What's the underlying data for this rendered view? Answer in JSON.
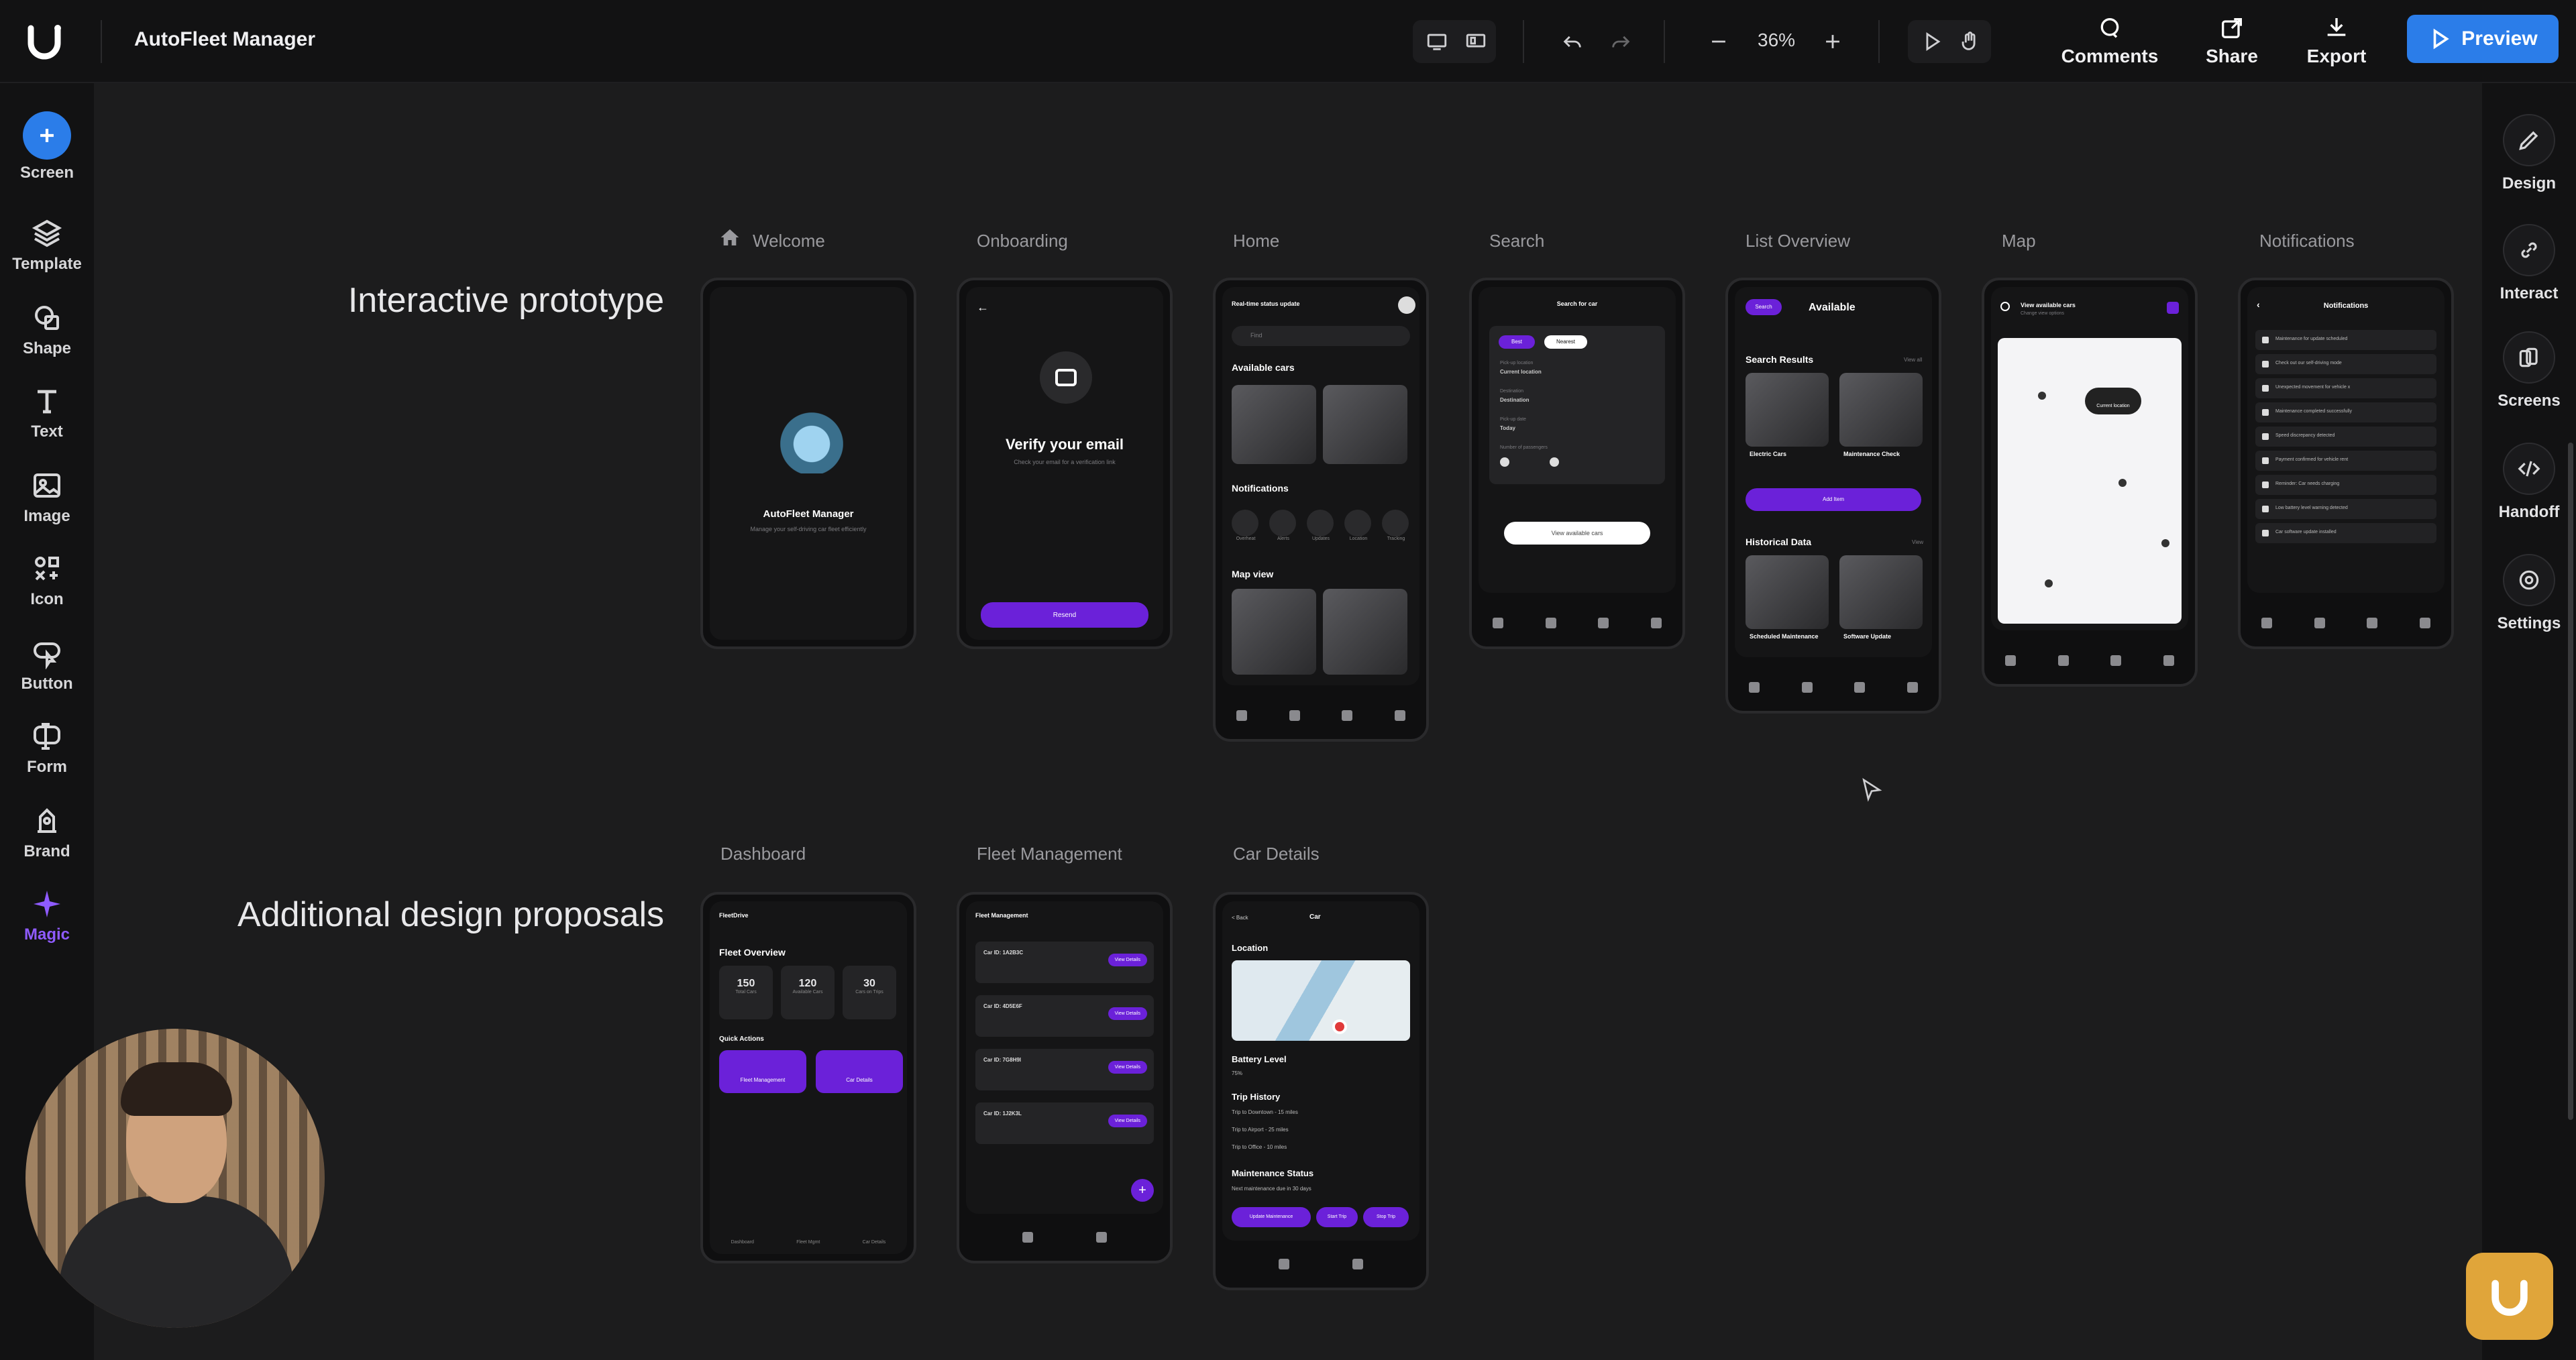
{
  "topbar": {
    "app_title": "AutoFleet Manager",
    "zoom": "36%",
    "actions": {
      "comments": "Comments",
      "share": "Share",
      "export": "Export"
    },
    "preview": "Preview"
  },
  "left_toolbar": [
    {
      "label": "Screen",
      "icon": "plus-icon"
    },
    {
      "label": "Template",
      "icon": "layers-icon"
    },
    {
      "label": "Shape",
      "icon": "shape-icon"
    },
    {
      "label": "Text",
      "icon": "text-icon"
    },
    {
      "label": "Image",
      "icon": "image-icon"
    },
    {
      "label": "Icon",
      "icon": "icon-grid-icon"
    },
    {
      "label": "Button",
      "icon": "button-icon"
    },
    {
      "label": "Form",
      "icon": "form-icon"
    },
    {
      "label": "Brand",
      "icon": "brand-icon"
    },
    {
      "label": "Magic",
      "icon": "sparkle-icon"
    }
  ],
  "right_toolbar": [
    {
      "label": "Design",
      "icon": "pencil-icon"
    },
    {
      "label": "Interact",
      "icon": "link-icon"
    },
    {
      "label": "Screens",
      "icon": "screens-icon"
    },
    {
      "label": "Handoff",
      "icon": "code-icon"
    },
    {
      "label": "Settings",
      "icon": "gear-icon"
    }
  ],
  "sections": {
    "prototype": "Interactive prototype",
    "proposals": "Additional design proposals"
  },
  "screens_row1": [
    "Welcome",
    "Onboarding",
    "Home",
    "Search",
    "List Overview",
    "Map",
    "Notifications"
  ],
  "screens_row2": [
    "Dashboard",
    "Fleet Management",
    "Car Details"
  ],
  "phones": {
    "welcome": {
      "title": "AutoFleet Manager",
      "subtitle": "Manage your self-driving car fleet efficiently"
    },
    "onboarding": {
      "title": "Verify your email",
      "subtitle": "Check your email for a verification link",
      "button": "Resend"
    },
    "home": {
      "header": "Real-time status update",
      "search": "Find",
      "available": "Available cars",
      "notifications": "Notifications",
      "mapview": "Map view",
      "notif_items": [
        "Overheat",
        "Alerts",
        "Updates",
        "Location",
        "Tracking"
      ]
    },
    "search": {
      "header": "Search for car",
      "tab_a": "Best",
      "tab_b": "Nearest",
      "f1": "Pick-up location",
      "v1": "Current location",
      "f2": "Destination",
      "v2": "Destination",
      "f3": "Pick-up date",
      "v3": "Today",
      "f4": "Number of passengers",
      "button": "View available cars"
    },
    "list": {
      "chip": "Search",
      "title": "Available",
      "results": "Search Results",
      "viewall": "View all",
      "c1": "Electric Cars",
      "c2": "Maintenance Check",
      "add": "Add Item",
      "hist": "Historical Data",
      "view": "View",
      "h1": "Scheduled Maintenance",
      "h2": "Software Update"
    },
    "map": {
      "title": "View available cars",
      "subtitle": "Change view options",
      "pin": "Current location"
    },
    "notifications": {
      "title": "Notifications",
      "items": [
        "Maintenance for update scheduled",
        "Check out our self-driving mode",
        "Unexpected movement for vehicle x",
        "Maintenance completed successfully",
        "Speed discrepancy detected",
        "Payment confirmed for vehicle rent",
        "Reminder: Car needs charging",
        "Low battery level warning detected",
        "Car software update installed"
      ]
    },
    "dashboard": {
      "brand": "FleetDrive",
      "overview": "Fleet Overview",
      "stats": [
        {
          "value": "150",
          "label": "Total Cars"
        },
        {
          "value": "120",
          "label": "Available Cars"
        },
        {
          "value": "30",
          "label": "Cars on Trips"
        }
      ],
      "quick": "Quick Actions",
      "qa1": "Fleet Management",
      "qa2": "Car Details",
      "nav": [
        "Dashboard",
        "Fleet Mgmt",
        "Car Details"
      ]
    },
    "fleet": {
      "title": "Fleet Management",
      "cars": [
        "Car ID: 1A2B3C",
        "Car ID: 4D5E6F",
        "Car ID: 7G8H9I",
        "Car ID: 1J2K3L"
      ],
      "btn": "View Details"
    },
    "details": {
      "back": "< Back",
      "title": "Car",
      "location": "Location",
      "battery": "Battery Level",
      "battery_val": "75%",
      "trip": "Trip History",
      "trips": [
        "Trip to Downtown - 15 miles",
        "Trip to Airport - 25 miles",
        "Trip to Office - 10 miles"
      ],
      "maint": "Maintenance Status",
      "maint_val": "Next maintenance due in 30 days",
      "b1": "Update Maintenance",
      "b2": "Start Trip",
      "b3": "Stop Trip"
    }
  },
  "colors": {
    "accent": "#2b7de9",
    "purple": "#6b21d9",
    "badge": "#e0a53a",
    "canvas": "#1c1c1d"
  }
}
